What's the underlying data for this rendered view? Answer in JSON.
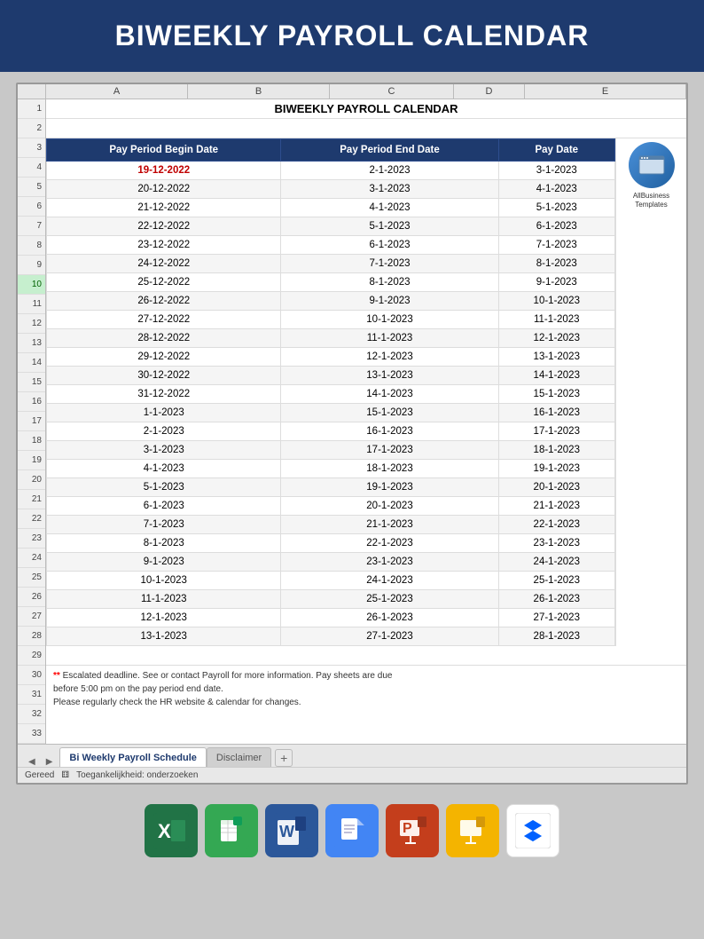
{
  "header": {
    "title": "BIWEEKLY PAYROLL CALENDAR"
  },
  "spreadsheet": {
    "title": "BIWEEKLY PAYROLL CALENDAR",
    "columns": {
      "letters": [
        "A",
        "B",
        "C",
        "D",
        "E"
      ],
      "widths": [
        160,
        160,
        140,
        80,
        40
      ]
    },
    "headers": {
      "col1": "Pay Period Begin Date",
      "col2": "Pay Period End Date",
      "col3": "Pay Date"
    },
    "rows": [
      {
        "begin": "19-12-2022",
        "end": "2-1-2023",
        "pay": "3-1-2023",
        "highlight": true
      },
      {
        "begin": "20-12-2022",
        "end": "3-1-2023",
        "pay": "4-1-2023"
      },
      {
        "begin": "21-12-2022",
        "end": "4-1-2023",
        "pay": "5-1-2023"
      },
      {
        "begin": "22-12-2022",
        "end": "5-1-2023",
        "pay": "6-1-2023"
      },
      {
        "begin": "23-12-2022",
        "end": "6-1-2023",
        "pay": "7-1-2023"
      },
      {
        "begin": "24-12-2022",
        "end": "7-1-2023",
        "pay": "8-1-2023"
      },
      {
        "begin": "25-12-2022",
        "end": "8-1-2023",
        "pay": "9-1-2023"
      },
      {
        "begin": "26-12-2022",
        "end": "9-1-2023",
        "pay": "10-1-2023"
      },
      {
        "begin": "27-12-2022",
        "end": "10-1-2023",
        "pay": "11-1-2023"
      },
      {
        "begin": "28-12-2022",
        "end": "11-1-2023",
        "pay": "12-1-2023"
      },
      {
        "begin": "29-12-2022",
        "end": "12-1-2023",
        "pay": "13-1-2023"
      },
      {
        "begin": "30-12-2022",
        "end": "13-1-2023",
        "pay": "14-1-2023"
      },
      {
        "begin": "31-12-2022",
        "end": "14-1-2023",
        "pay": "15-1-2023"
      },
      {
        "begin": "1-1-2023",
        "end": "15-1-2023",
        "pay": "16-1-2023"
      },
      {
        "begin": "2-1-2023",
        "end": "16-1-2023",
        "pay": "17-1-2023"
      },
      {
        "begin": "3-1-2023",
        "end": "17-1-2023",
        "pay": "18-1-2023"
      },
      {
        "begin": "4-1-2023",
        "end": "18-1-2023",
        "pay": "19-1-2023"
      },
      {
        "begin": "5-1-2023",
        "end": "19-1-2023",
        "pay": "20-1-2023"
      },
      {
        "begin": "6-1-2023",
        "end": "20-1-2023",
        "pay": "21-1-2023"
      },
      {
        "begin": "7-1-2023",
        "end": "21-1-2023",
        "pay": "22-1-2023"
      },
      {
        "begin": "8-1-2023",
        "end": "22-1-2023",
        "pay": "23-1-2023"
      },
      {
        "begin": "9-1-2023",
        "end": "23-1-2023",
        "pay": "24-1-2023"
      },
      {
        "begin": "10-1-2023",
        "end": "24-1-2023",
        "pay": "25-1-2023"
      },
      {
        "begin": "11-1-2023",
        "end": "25-1-2023",
        "pay": "26-1-2023"
      },
      {
        "begin": "12-1-2023",
        "end": "26-1-2023",
        "pay": "27-1-2023"
      },
      {
        "begin": "13-1-2023",
        "end": "27-1-2023",
        "pay": "28-1-2023"
      }
    ],
    "row_numbers": [
      1,
      2,
      3,
      4,
      5,
      6,
      7,
      8,
      9,
      10,
      11,
      12,
      13,
      14,
      15,
      16,
      17,
      18,
      19,
      20,
      21,
      22,
      23,
      24,
      25,
      26,
      27,
      28,
      29,
      30,
      31,
      32,
      33
    ],
    "footer_notes": [
      "** Escalated deadline. See  or contact Payroll for more information. Pay sheets are due",
      "before 5:00 pm on the pay period end date.",
      "Please regularly check the HR website & calendar for changes."
    ]
  },
  "tabs": {
    "active": "Bi Weekly Payroll Schedule",
    "inactive": "Disclaimer",
    "add_label": "+"
  },
  "status_bar": {
    "text": "Gereed",
    "accessibility": "Toegankelijkheid: onderzoeken"
  },
  "logo": {
    "line1": "AllBusiness",
    "line2": "Templates"
  },
  "app_icons": [
    {
      "name": "Excel",
      "type": "excel"
    },
    {
      "name": "Sheets",
      "type": "sheets"
    },
    {
      "name": "Word",
      "type": "word"
    },
    {
      "name": "Docs",
      "type": "docs"
    },
    {
      "name": "PowerPoint",
      "type": "ppt"
    },
    {
      "name": "Slides",
      "type": "slides"
    },
    {
      "name": "Dropbox",
      "type": "dropbox"
    }
  ]
}
